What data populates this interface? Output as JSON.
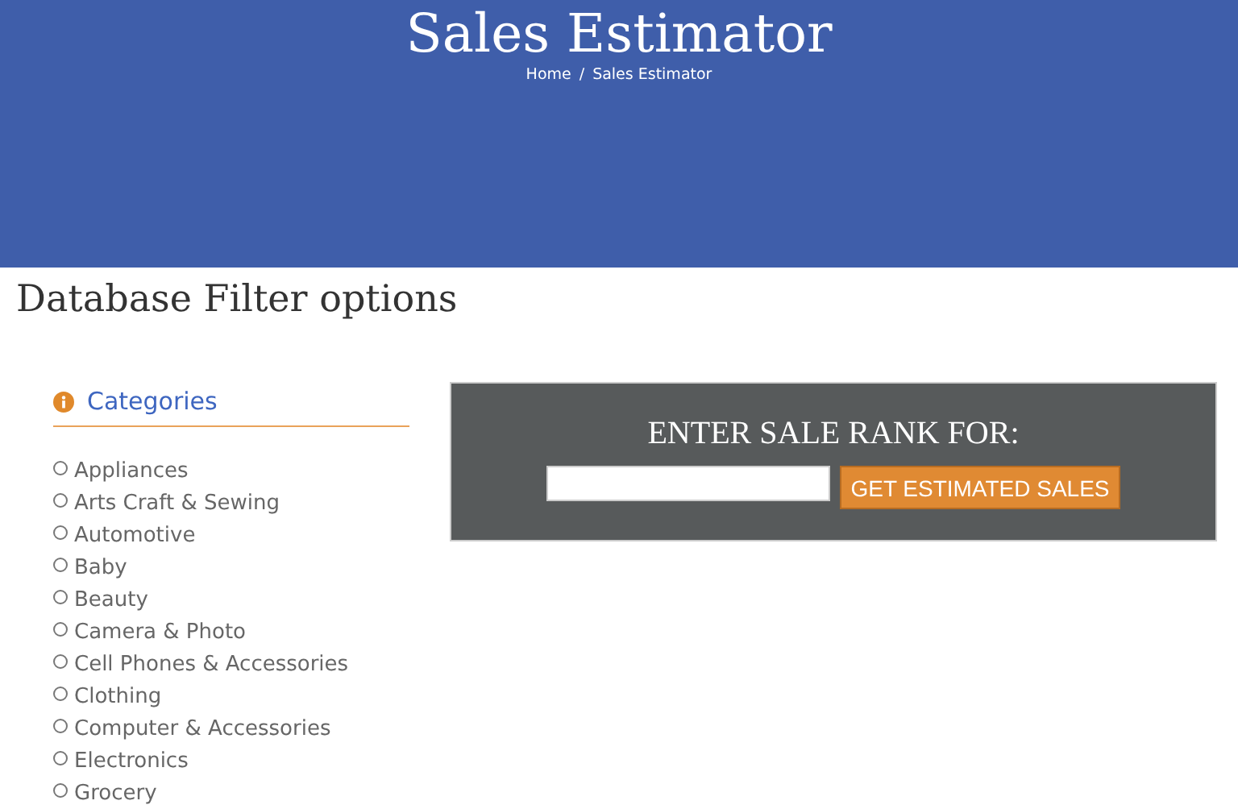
{
  "header": {
    "title": "Sales Estimator",
    "breadcrumb": [
      "Home",
      "/",
      "Sales Estimator"
    ]
  },
  "page_title": "Database Filter options",
  "sidebar": {
    "heading": "Categories",
    "items": [
      {
        "label": "Appliances",
        "selected": false
      },
      {
        "label": "Arts Craft & Sewing",
        "selected": false
      },
      {
        "label": "Automotive",
        "selected": false
      },
      {
        "label": "Baby",
        "selected": false
      },
      {
        "label": "Beauty",
        "selected": false
      },
      {
        "label": "Camera & Photo",
        "selected": false
      },
      {
        "label": "Cell Phones & Accessories",
        "selected": false
      },
      {
        "label": "Clothing",
        "selected": false
      },
      {
        "label": "Computer & Accessories",
        "selected": false
      },
      {
        "label": "Electronics",
        "selected": false
      },
      {
        "label": "Grocery",
        "selected": false
      }
    ]
  },
  "rank_panel": {
    "heading": "ENTER SALE RANK FOR:",
    "button": "GET ESTIMATED SALES"
  }
}
